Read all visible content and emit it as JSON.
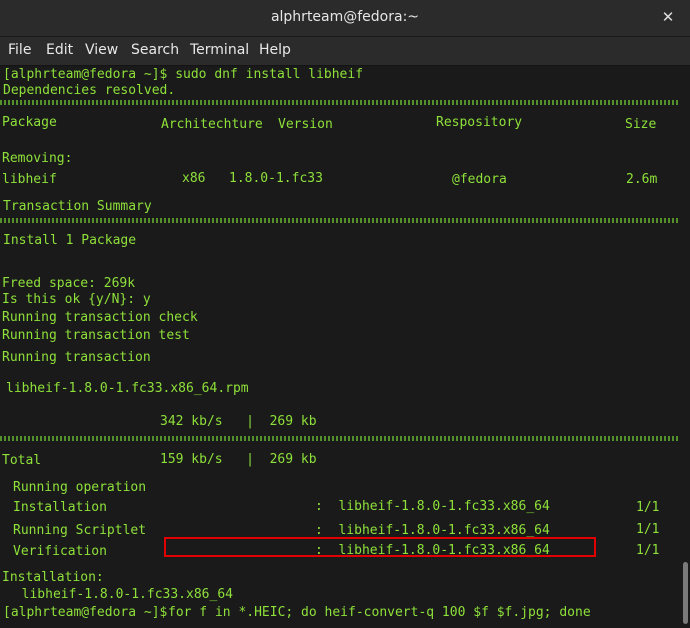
{
  "window": {
    "title": "alphrteam@fedora:~",
    "close_glyph": "✕"
  },
  "menu": [
    "File",
    "Edit",
    "View",
    "Search",
    "Terminal",
    "Help"
  ],
  "terminal": {
    "prompt": "[alphrteam@fedora ~]$",
    "cmd1": " sudo dnf install libheif",
    "deps": "Dependencies resolved.",
    "hdr": {
      "package": "Package",
      "arch": "Architechture",
      "version": "Version",
      "repo": "Respository",
      "size": "Size"
    },
    "removing": "Removing:",
    "row": {
      "name": "libheif",
      "arch": "x86",
      "version": "1.8.0-1.fc33",
      "repo": "@fedora",
      "size": "2.6m"
    },
    "summary": "Transaction Summary",
    "install": "Install 1 Package",
    "freed": "Freed space: 269k",
    "confirm": "Is this ok {y/N}: y",
    "check": "Running transaction check",
    "test": "Running transaction test",
    "running": "Running transaction",
    "rpm": "libheif-1.8.0-1.fc33.x86_64.rpm",
    "rate1": "342 kb/s   |  269 kb",
    "total_label": "Total",
    "rate2": "159 kb/s   |  269 kb",
    "running_op": "Running operation",
    "steps": [
      {
        "label": "Installation",
        "pkg": ":  libheif-1.8.0-1.fc33.x86_64",
        "count": "1/1"
      },
      {
        "label": "Running Scriptlet",
        "pkg": ":  libheif-1.8.0-1.fc33.x86_64",
        "count": "1/1"
      },
      {
        "label": "Verification",
        "pkg": ":  libheif-1.8.0-1.fc33.x86_64",
        "count": "1/1"
      }
    ],
    "installation": "Installation:",
    "installed_pkg": "  libheif-1.8.0-1.fc33.x86_64",
    "cmd2": "for f in *.HEIC; do heif-convert-q 100 $f $f.jpg; done"
  },
  "colors": {
    "terminal_text": "#8ee03a",
    "highlight_box": "#e00000"
  }
}
